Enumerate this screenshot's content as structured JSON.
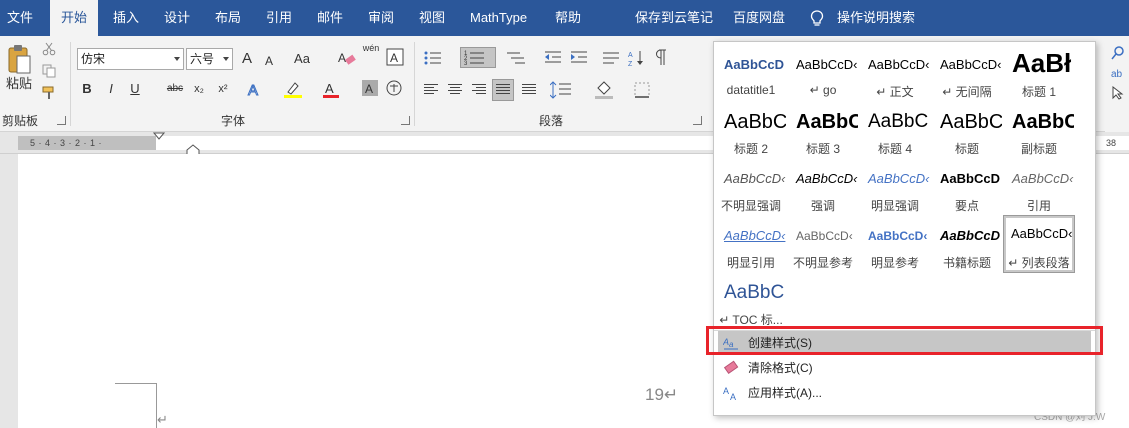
{
  "menubar": {
    "tabs": [
      {
        "label": "文件"
      },
      {
        "label": "开始"
      },
      {
        "label": "插入"
      },
      {
        "label": "设计"
      },
      {
        "label": "布局"
      },
      {
        "label": "引用"
      },
      {
        "label": "邮件"
      },
      {
        "label": "审阅"
      },
      {
        "label": "视图"
      },
      {
        "label": "MathType"
      },
      {
        "label": "帮助"
      },
      {
        "label": "保存到云笔记"
      },
      {
        "label": "百度网盘"
      },
      {
        "label": "操作说明搜索"
      }
    ],
    "active_tab": "开始"
  },
  "ribbon": {
    "clipboard": {
      "paste_label": "粘贴",
      "group_label": "剪贴板"
    },
    "font": {
      "font_name": "仿宋",
      "font_size": "六号",
      "grow": "A",
      "shrink": "A",
      "case": "Aa",
      "pinyin": "wén",
      "bold": "B",
      "italic": "I",
      "underline": "U",
      "strike": "abc",
      "subscript": "x₂",
      "superscript": "x²",
      "group_label": "字体"
    },
    "paragraph": {
      "group_label": "段落"
    }
  },
  "ruler": {
    "left_numbers": "5 · 4 · 3 · 2 · 1 ·",
    "right_number": "38"
  },
  "document": {
    "page_number": "19↵",
    "return_mark": "↵"
  },
  "gallery": {
    "styles": [
      {
        "preview": "AaBbCcD",
        "name": "datatitle1"
      },
      {
        "preview": "AaBbCcD‹",
        "name": "↵ go"
      },
      {
        "preview": "AaBbCcD‹",
        "name": "↵ 正文"
      },
      {
        "preview": "AaBbCcD‹",
        "name": "↵ 无间隔"
      },
      {
        "preview": "AaBł",
        "name": "标题 1"
      },
      {
        "preview": "AaBbC",
        "name": "标题 2"
      },
      {
        "preview": "AaBbC",
        "name": "标题 3"
      },
      {
        "preview": "AaBbC",
        "name": "标题 4"
      },
      {
        "preview": "AaBbC",
        "name": "标题"
      },
      {
        "preview": "AaBbC",
        "name": "副标题"
      },
      {
        "preview": "AaBbCcD‹",
        "name": "不明显强调"
      },
      {
        "preview": "AaBbCcD‹",
        "name": "强调"
      },
      {
        "preview": "AaBbCcD‹",
        "name": "明显强调"
      },
      {
        "preview": "AaBbCcD",
        "name": "要点"
      },
      {
        "preview": "AaBbCcD‹",
        "name": "引用"
      },
      {
        "preview": "AaBbCcD‹",
        "name": "明显引用"
      },
      {
        "preview": "AaBbCcD‹",
        "name": "不明显参考"
      },
      {
        "preview": "AaBbCcD‹",
        "name": "明显参考"
      },
      {
        "preview": "AaBbCcD",
        "name": "书籍标题"
      },
      {
        "preview": "AaBbCcD‹",
        "name": "↵ 列表段落"
      },
      {
        "preview": "AaBbC",
        "name": "↵ TOC 标..."
      }
    ],
    "commands": [
      {
        "label": "创建样式(S)"
      },
      {
        "label": "清除格式(C)"
      },
      {
        "label": "应用样式(A)..."
      }
    ]
  },
  "watermark": "CSDN @刘 J.W"
}
